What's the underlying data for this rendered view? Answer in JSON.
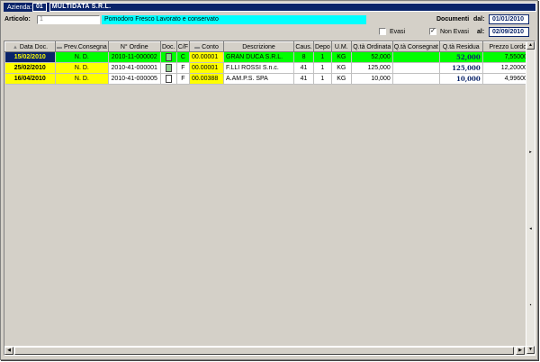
{
  "azienda": {
    "label": "Azienda:",
    "code": "01",
    "name": "MULTIDATA S.R.L."
  },
  "articolo": {
    "label": "Articolo:",
    "code": "1",
    "description": "Pomodoro Fresco Lavorato e conservato"
  },
  "documenti": {
    "label": "Documenti",
    "dal_label": "dal:",
    "dal": "01/01/2010",
    "al_label": "al:",
    "al": "02/09/2010"
  },
  "filters": {
    "evasi_label": "Evasi",
    "evasi_checked": false,
    "non_evasi_label": "Non Evasi",
    "non_evasi_checked": true
  },
  "columns": [
    "Data Doc.",
    "Prev.Consegna",
    "N° Ordine",
    "Doc.",
    "C/F",
    "Conto",
    "Descrizione",
    "Caus.",
    "Depo",
    "U.M.",
    "Q.tà Ordinata",
    "Q.tà Consegnat",
    "Q.tà Residua",
    "Prezzo Lordo"
  ],
  "rows": [
    {
      "data": "15/02/2010",
      "prev": "N. D.",
      "ordine": "2010-11-000002",
      "doc": "green-document-icon",
      "cf": "C",
      "conto": "00.00001",
      "descr": "GRAN DUCA S.R.L.",
      "caus": "8",
      "depo": "1",
      "um": "KG",
      "ordinata": "52,000",
      "consegnata": "",
      "residua": "52,000",
      "prezzo": "7,550000"
    },
    {
      "data": "25/02/2010",
      "prev": "N. D.",
      "ordine": "2010-41-000001",
      "doc": "green-document-icon",
      "cf": "F",
      "conto": "00.00001",
      "descr": "F.LLI ROSSI S.n.c.",
      "caus": "41",
      "depo": "1",
      "um": "KG",
      "ordinata": "125,000",
      "consegnata": "",
      "residua": "125,000",
      "prezzo": "12,200000"
    },
    {
      "data": "16/04/2010",
      "prev": "N. D.",
      "ordine": "2010-41-000005",
      "doc": "white-document-icon",
      "cf": "F",
      "conto": "00.00388",
      "descr": "A.AM.P.S. SPA",
      "caus": "41",
      "depo": "1",
      "um": "KG",
      "ordinata": "10,000",
      "consegnata": "",
      "residua": "10,000",
      "prezzo": "4,996000"
    }
  ],
  "colors": {
    "selected_row": "#00ff00",
    "date_cell": "#ffff00",
    "header_bar": "#0a246a",
    "article_desc_bg": "#00ffff"
  }
}
